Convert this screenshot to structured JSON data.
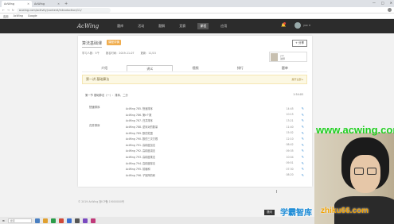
{
  "browser": {
    "tabs": [
      {
        "title": "AcWing"
      },
      {
        "title": "AcWing"
      }
    ],
    "new_tab": "+",
    "window_controls": [
      "—",
      "□",
      "✕"
    ],
    "url": "acwing.com/activity/content/introduction/11/",
    "bookmarks": [
      "应用",
      "AcWing",
      "Google"
    ]
  },
  "nav": {
    "logo": "AcWing",
    "items": [
      "题库",
      "活动",
      "题解",
      "竞赛",
      "课程",
      "应用"
    ],
    "active_index": 4,
    "username": "yxc ▾"
  },
  "course": {
    "title": "算法基础课",
    "badge": "课程详情",
    "share_label": "+ 分享",
    "meta": [
      "学习人数：5千",
      "报名时间：2019-11-07",
      "更新：11/15"
    ],
    "teacher_name": "yxc",
    "teacher_sub": "讲师",
    "tabs": [
      "介绍",
      "讲义",
      "视频",
      "排行",
      "题单"
    ],
    "active_tab": 1,
    "section_title": "第一讲 基础算法",
    "section_right": "展开全部 ▸",
    "lecture": {
      "title": "第一节 基础算法（一）：排序、二分",
      "duration": "1:54:05"
    },
    "groups": [
      "快速排序",
      "归并排序"
    ],
    "items": [
      {
        "title": "AcWing 785. 快速排序",
        "duration": "14:45"
      },
      {
        "title": "AcWing 786. 第k个数",
        "duration": "10:15"
      },
      {
        "title": "AcWing 787. 归并排序",
        "duration": "13:21"
      },
      {
        "title": "AcWing 788. 逆序对的数量",
        "duration": "11:40"
      },
      {
        "title": "AcWing 789. 数的范围",
        "duration": "15:02"
      },
      {
        "title": "AcWing 790. 数的三次方根",
        "duration": "12:10"
      },
      {
        "title": "AcWing 791. 高精度加法",
        "duration": "08:42"
      },
      {
        "title": "AcWing 792. 高精度减法",
        "duration": "09:35"
      },
      {
        "title": "AcWing 793. 高精度乘法",
        "duration": "10:04"
      },
      {
        "title": "AcWing 794. 高精度除法",
        "duration": "09:51"
      },
      {
        "title": "AcWing 795. 前缀和",
        "duration": "07:30"
      },
      {
        "title": "AcWing 796. 子矩阵的和",
        "duration": "08:20"
      }
    ]
  },
  "footer": "© 2019 AcWing 浙ICP备 19000000号",
  "cursor": "I",
  "ask_button": "提问",
  "taskbar": {
    "search_placeholder": "搜索"
  },
  "watermarks": {
    "acwing": "www.acwing.com",
    "xueba": "学霸智库",
    "zhiku": "zhiku66.com"
  },
  "colors": {
    "nav_bg": "#2c2c2c",
    "badge": "#f0ad4e",
    "section_bg": "#fcf8e3",
    "edit_icon": "#3b8ed6"
  }
}
